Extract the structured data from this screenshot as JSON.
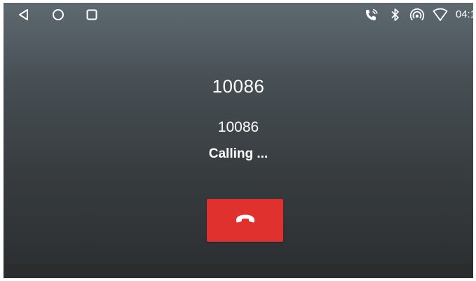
{
  "status_bar": {
    "clock": "04:1",
    "icons": [
      "phone-call-icon",
      "bluetooth-icon",
      "hotspot-icon",
      "wifi-icon"
    ]
  },
  "nav_bar": {
    "icons": [
      "back-icon",
      "home-icon",
      "recents-icon"
    ]
  },
  "call": {
    "name": "10086",
    "number": "10086",
    "status": "Calling ..."
  },
  "colors": {
    "end_call": "#e0312f",
    "text": "#ffffff"
  }
}
